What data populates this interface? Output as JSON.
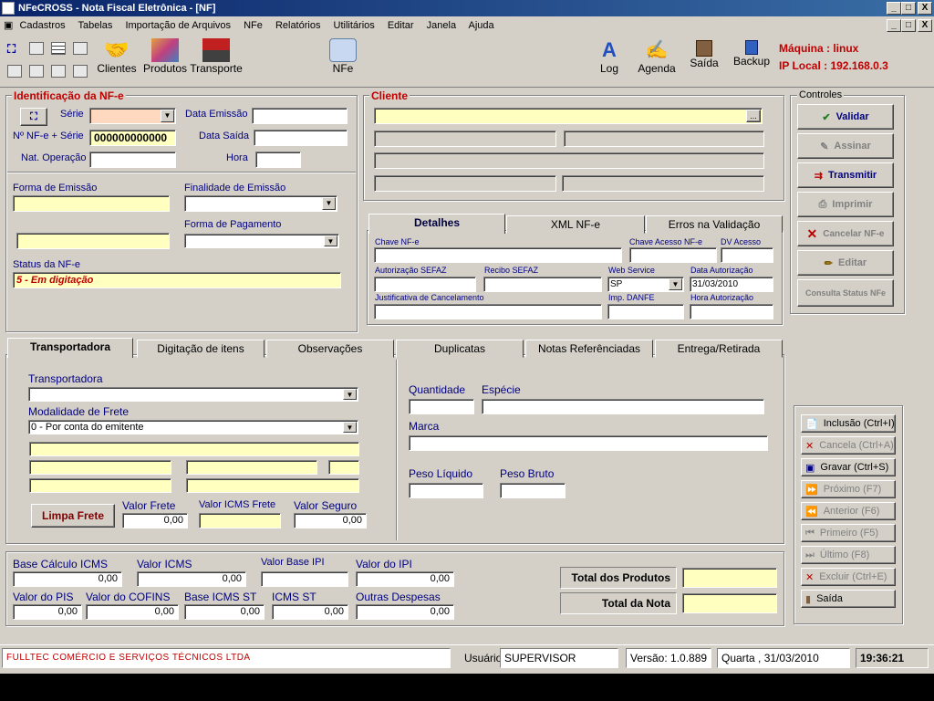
{
  "window": {
    "title": "NFeCROSS - Nota Fiscal Eletrônica - [NF]",
    "min": "_",
    "max": "□",
    "close": "X"
  },
  "menu": [
    "Cadastros",
    "Tabelas",
    "Importação de Arquivos",
    "NFe",
    "Relatórios",
    "Utilitários",
    "Editar",
    "Janela",
    "Ajuda"
  ],
  "toolbar": {
    "clientes": "Clientes",
    "produtos": "Produtos",
    "transporte": "Transporte",
    "nfe": "NFe",
    "log": "Log",
    "agenda": "Agenda",
    "saida": "Saída",
    "backup": "Backup",
    "maquina": "Máquina : linux",
    "ip": "IP Local : 192.168.0.3"
  },
  "ident": {
    "title": "Identificação da NF-e",
    "serie": "Série",
    "data_emissao": "Data Emissão",
    "nfe_serie": "Nº NF-e + Série",
    "nfe_serie_value": "000000000000",
    "data_saida": "Data Saída",
    "nat_operacao": "Nat. Operação",
    "hora": "Hora",
    "forma_emissao": "Forma de Emissão",
    "finalidade": "Finalidade de Emissão",
    "forma_pagamento": "Forma de Pagamento",
    "status_label": "Status da NF-e",
    "status_value": "5 - Em digitação"
  },
  "cliente": {
    "title": "Cliente",
    "ellipsis": "..."
  },
  "detalhes": {
    "tabs": [
      "Detalhes",
      "XML NF-e",
      "Erros na Validação"
    ],
    "chave": "Chave NF-e",
    "chave_acesso": "Chave Acesso NF-e",
    "dv": "DV Acesso",
    "autorizacao": "Autorização SEFAZ",
    "recibo": "Recibo SEFAZ",
    "webservice": "Web Service",
    "webservice_value": "SP",
    "data_autorizacao": "Data Autorização",
    "data_autorizacao_value": "31/03/2010",
    "justificativa": "Justificativa de Cancelamento",
    "imp_danfe": "Imp. DANFE",
    "hora_autorizacao": "Hora Autorização"
  },
  "controles": {
    "title": "Controles",
    "validar": "Validar",
    "assinar": "Assinar",
    "transmitir": "Transmitir",
    "imprimir": "Imprimir",
    "cancelar": "Cancelar NF-e",
    "editar": "Editar",
    "consulta": "Consulta Status NFe"
  },
  "tabs": [
    "Transportadora",
    "Digitação de itens",
    "Observações",
    "Duplicatas",
    "Notas Referênciadas",
    "Entrega/Retirada"
  ],
  "transp": {
    "transportadora": "Transportadora",
    "modalidade": "Modalidade de Frete",
    "modalidade_value": "0 - Por conta do emitente",
    "limpa": "Limpa Frete",
    "valor_frete": "Valor Frete",
    "valor_frete_value": "0,00",
    "valor_icms_frete": "Valor ICMS Frete",
    "valor_seguro": "Valor Seguro",
    "valor_seguro_value": "0,00",
    "quantidade": "Quantidade",
    "especie": "Espécie",
    "marca": "Marca",
    "peso_liquido": "Peso Líquido",
    "peso_bruto": "Peso Bruto"
  },
  "totais": {
    "base_icms": "Base Cálculo  ICMS",
    "base_icms_v": "0,00",
    "valor_icms": "Valor ICMS",
    "valor_icms_v": "0,00",
    "base_ipi": "Valor Base IPI",
    "valor_ipi": "Valor do IPI",
    "valor_ipi_v": "0,00",
    "pis": "Valor do PIS",
    "pis_v": "0,00",
    "cofins": "Valor do COFINS",
    "cofins_v": "0,00",
    "base_st": "Base ICMS ST",
    "base_st_v": "0,00",
    "icms_st": "ICMS ST",
    "icms_st_v": "0,00",
    "outras": "Outras Despesas",
    "outras_v": "0,00",
    "total_produtos": "Total dos Produtos",
    "total_nota": "Total da Nota"
  },
  "nav": {
    "inclusao": "Inclusão (Ctrl+I)",
    "cancela": "Cancela (Ctrl+A)",
    "gravar": "Gravar (Ctrl+S)",
    "proximo": "Próximo (F7)",
    "anterior": "Anterior (F6)",
    "primeiro": "Primeiro (F5)",
    "ultimo": "Último   (F8)",
    "excluir": "Excluir (Ctrl+E)",
    "saida": "Saída"
  },
  "status": {
    "company": "FULLTEC COMÉRCIO E SERVIÇOS TÉCNICOS LTDA",
    "usuario_label": "Usuário",
    "usuario": "SUPERVISOR",
    "versao": "Versão: 1.0.889",
    "data": "Quarta , 31/03/2010",
    "hora": "19:36:21"
  }
}
